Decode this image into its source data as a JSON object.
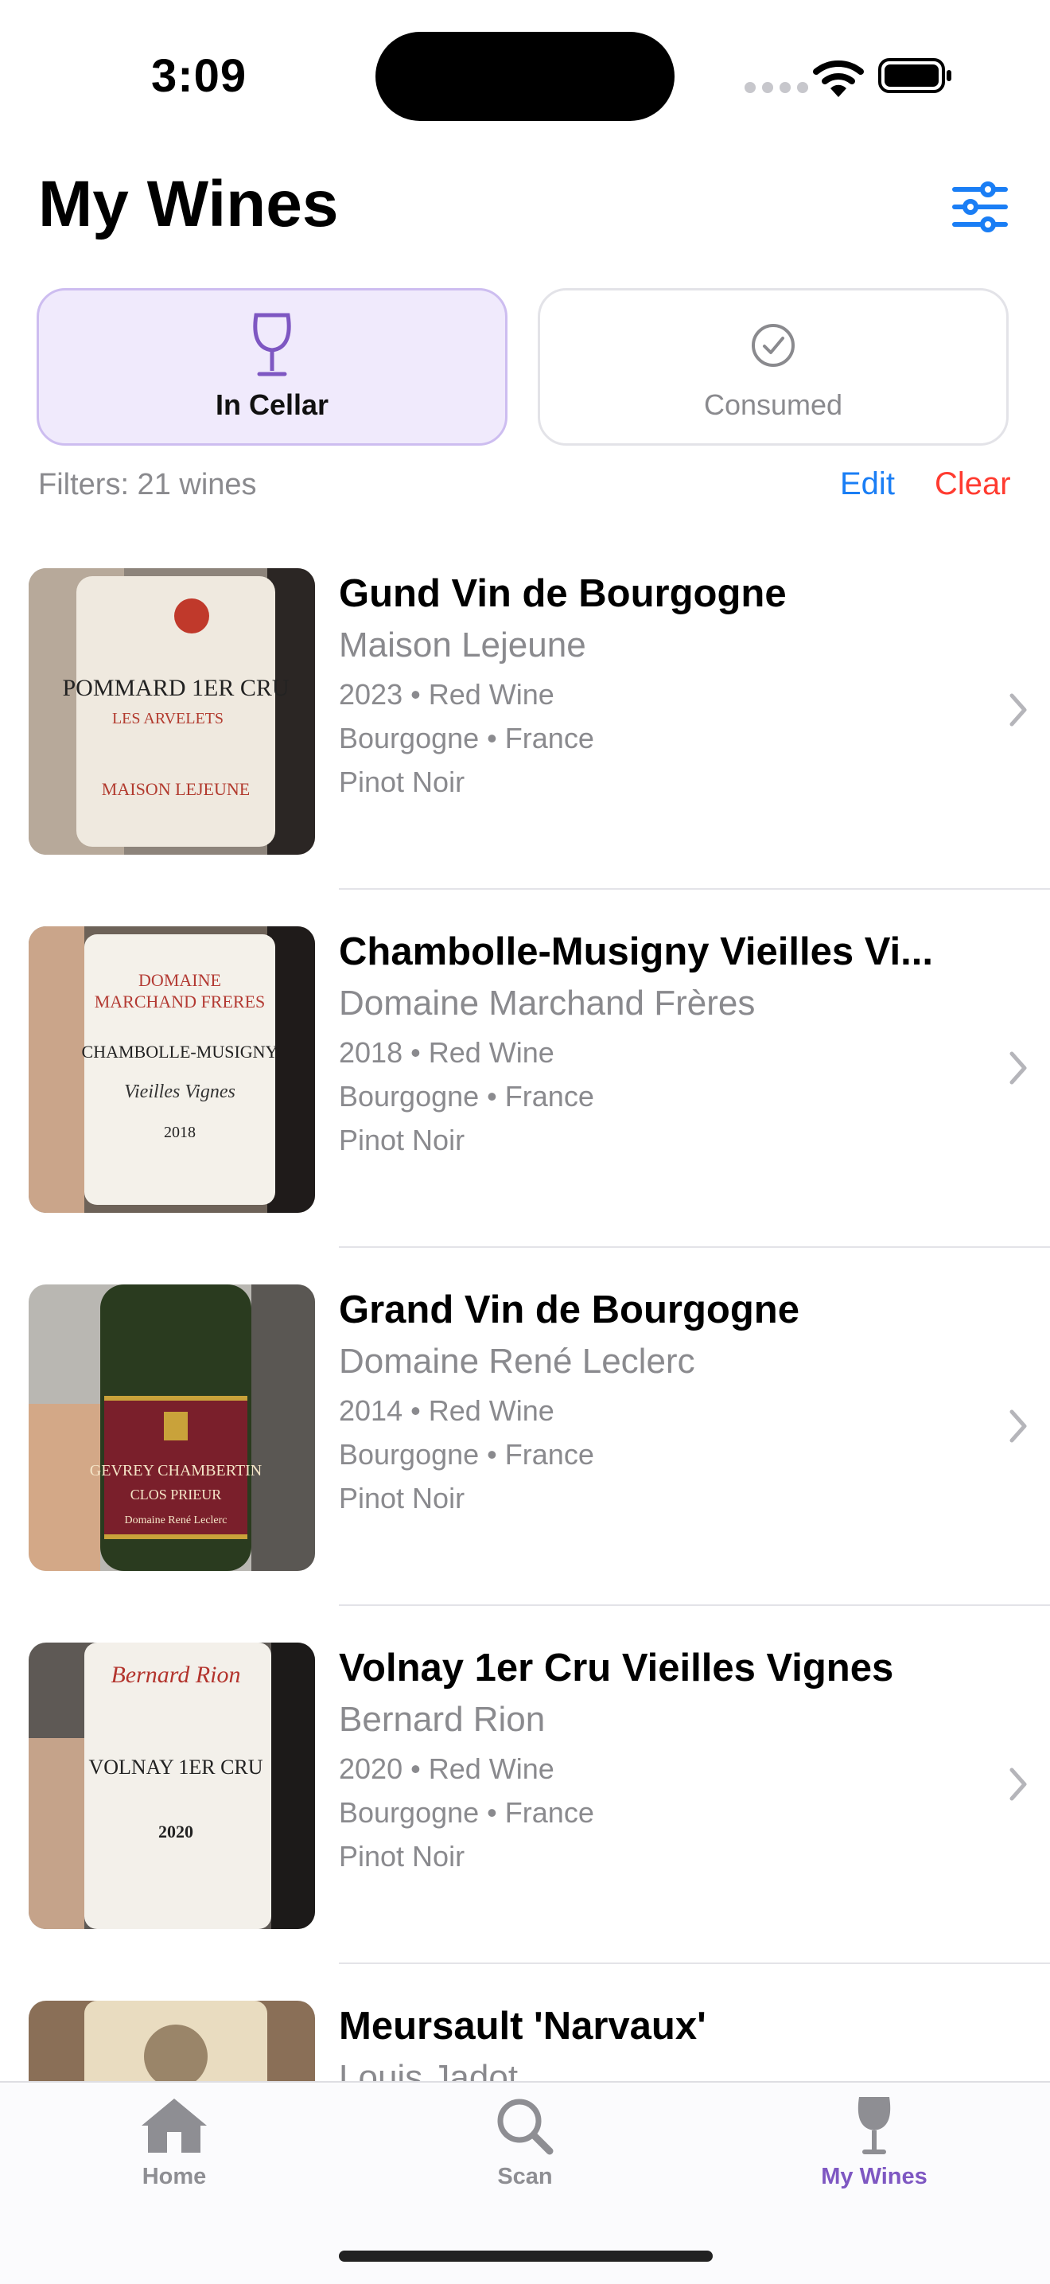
{
  "status_bar": {
    "time": "3:09"
  },
  "header": {
    "title": "My Wines"
  },
  "segments": [
    {
      "label": "In Cellar",
      "icon": "wine-glass-icon",
      "selected": true
    },
    {
      "label": "Consumed",
      "icon": "checkmark-circle-icon",
      "selected": false
    }
  ],
  "filters": {
    "summary": "Filters: 21 wines",
    "edit_label": "Edit",
    "clear_label": "Clear"
  },
  "wines": [
    {
      "name": "Gund Vin de Bourgogne",
      "producer": "Maison Lejeune",
      "vintage": "2023",
      "type": "Red Wine",
      "region": "Bourgogne",
      "country": "France",
      "grape": "Pinot Noir",
      "label_lines": [
        "POMMARD 1ER CRU",
        "LES ARVELETS",
        "MAISON LEJEUNE"
      ]
    },
    {
      "name": "Chambolle-Musigny Vieilles Vi...",
      "producer": "Domaine Marchand Frères",
      "vintage": "2018",
      "type": "Red Wine",
      "region": "Bourgogne",
      "country": "France",
      "grape": "Pinot Noir",
      "label_lines": [
        "DOMAINE",
        "MARCHAND FRERES",
        "CHAMBOLLE-MUSIGNY",
        "Vieilles Vignes",
        "2018"
      ]
    },
    {
      "name": "Grand Vin de Bourgogne",
      "producer": "Domaine René Leclerc",
      "vintage": "2014",
      "type": "Red Wine",
      "region": "Bourgogne",
      "country": "France",
      "grape": "Pinot Noir",
      "label_lines": [
        "GEVREY CHAMBERTIN",
        "CLOS PRIEUR",
        "Domaine René Leclerc"
      ]
    },
    {
      "name": "Volnay 1er Cru Vieilles Vignes",
      "producer": "Bernard Rion",
      "vintage": "2020",
      "type": "Red Wine",
      "region": "Bourgogne",
      "country": "France",
      "grape": "Pinot Noir",
      "label_lines": [
        "Bernard Rion",
        "VOLNAY 1ER CRU",
        "2020"
      ]
    },
    {
      "name": "Meursault 'Narvaux'",
      "producer": "Louis Jadot",
      "vintage": "",
      "type": "",
      "region": "",
      "country": "",
      "grape": "",
      "label_lines": []
    }
  ],
  "separator": "•",
  "tab_bar": [
    {
      "label": "Home",
      "icon": "house-icon",
      "active": false
    },
    {
      "label": "Scan",
      "icon": "magnifier-icon",
      "active": false
    },
    {
      "label": "My Wines",
      "icon": "wine-glass-icon",
      "active": true
    }
  ],
  "colors": {
    "accent": "#7e57c2",
    "link": "#1a7ef5",
    "destructive": "#ff3b30",
    "secondary_text": "#8a8a8e"
  }
}
